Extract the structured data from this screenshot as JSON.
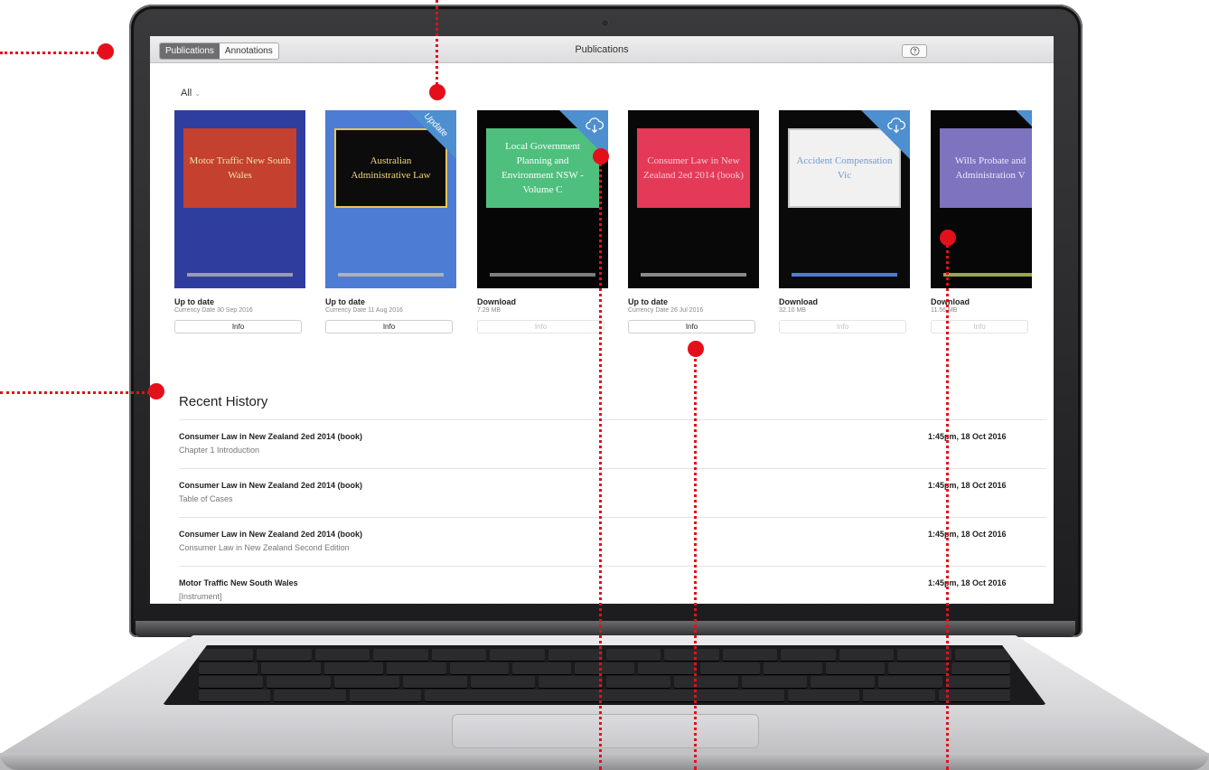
{
  "toolbar": {
    "tabs": [
      {
        "label": "Publications",
        "active": true
      },
      {
        "label": "Annotations",
        "active": false
      }
    ],
    "title": "Publications",
    "help_icon": "question-circle-icon"
  },
  "filter": {
    "label": "All",
    "icon": "chevron-down-icon"
  },
  "books": [
    {
      "title": "Motor Traffic New South Wales",
      "cover_bg": "#2f3e9e",
      "plate_bg": "#c4402f",
      "plate_text_color": "#f3e3a6",
      "rule_color": "#9b9bab",
      "status": "Up to date",
      "detail": "Currency Date 30 Sep 2016",
      "info_label": "Info",
      "info_enabled": true,
      "badge": ""
    },
    {
      "title": "Australian Administrative Law",
      "cover_bg": "#4c7cd3",
      "plate_bg": "#0c0c0c",
      "plate_text_color": "#f1d77a",
      "rule_color": "#b0b0b5",
      "status": "Up to date",
      "detail": "Currency Date 11 Aug 2016",
      "info_label": "Info",
      "info_enabled": true,
      "badge": "Update"
    },
    {
      "title": "Local Government Planning and Environment NSW - Volume C",
      "cover_bg": "#060606",
      "plate_bg": "#4fbf7e",
      "plate_text_color": "#ffffff",
      "rule_color": "#7e7e80",
      "status": "Download",
      "detail": "7.29 MB",
      "info_label": "Info",
      "info_enabled": false,
      "badge": "cloud-download-icon"
    },
    {
      "title": "Consumer Law in New Zealand 2ed 2014 (book)",
      "cover_bg": "#080808",
      "plate_bg": "#e43a57",
      "plate_text_color": "#f7c9d1",
      "rule_color": "#8a8a8c",
      "status": "Up to date",
      "detail": "Currency Date 26 Jul 2016",
      "info_label": "Info",
      "info_enabled": true,
      "badge": ""
    },
    {
      "title": "Accident Compensation Vic",
      "cover_bg": "#0a0a0a",
      "plate_bg": "#f1f1f1",
      "plate_text_color": "#6e9ad2",
      "rule_color": "#4c7cd3",
      "status": "Download",
      "detail": "32.10 MB",
      "info_label": "Info",
      "info_enabled": false,
      "badge": "cloud-download-icon"
    },
    {
      "title": "Wills Probate and Administration V",
      "cover_bg": "#070707",
      "plate_bg": "#7d73be",
      "plate_text_color": "#ecebff",
      "rule_color": "#9aa54f",
      "status": "Download",
      "detail": "11.56 MB",
      "info_label": "Info",
      "info_enabled": false,
      "badge": "corner"
    }
  ],
  "recent_history": {
    "title": "Recent History",
    "items": [
      {
        "book": "Consumer Law in New Zealand 2ed 2014 (book)",
        "section": "Chapter 1 Introduction",
        "time": "1:45pm, 18 Oct 2016"
      },
      {
        "book": "Consumer Law in New Zealand 2ed 2014 (book)",
        "section": "Table of Cases",
        "time": "1:45pm, 18 Oct 2016"
      },
      {
        "book": "Consumer Law in New Zealand 2ed 2014 (book)",
        "section": "Consumer Law in New Zealand Second Edition",
        "time": "1:45pm, 18 Oct 2016"
      },
      {
        "book": "Motor Traffic New South Wales",
        "section": "[Instrument]",
        "time": "1:45pm, 18 Oct 2016"
      }
    ]
  },
  "colors": {
    "annotation_red": "#e3101c",
    "ribbon_blue": "#4e8fcf"
  }
}
